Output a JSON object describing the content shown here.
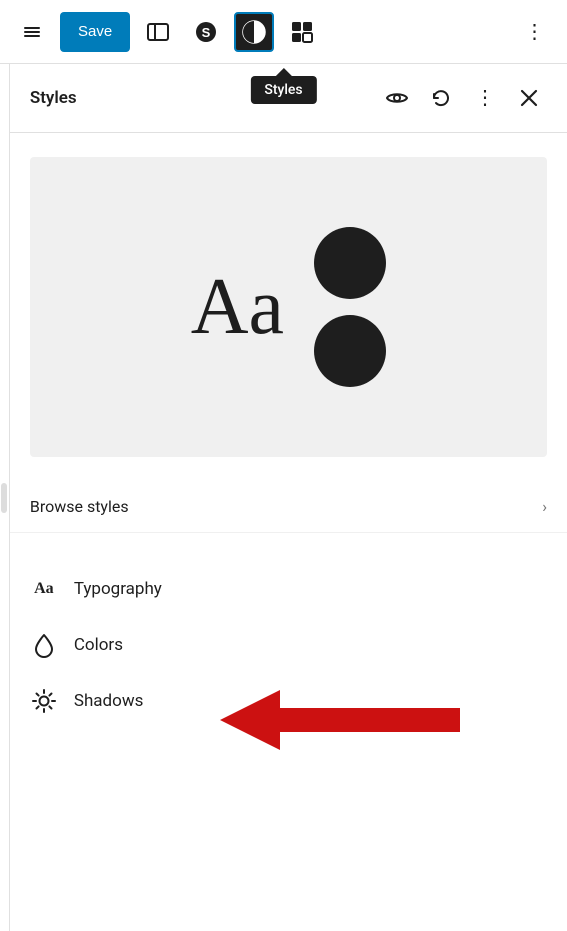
{
  "toolbar": {
    "save_label": "Save",
    "tooltip_label": "Styles",
    "layout_icon_label": "layout",
    "bolt_icon_label": "bolt",
    "styles_icon_label": "styles",
    "blocks_icon_label": "blocks",
    "more_icon_label": "more options"
  },
  "sidebar": {
    "title": "Styles",
    "eye_icon": "preview",
    "history_icon": "history",
    "more_icon": "more options",
    "close_icon": "close"
  },
  "preview": {
    "text": "Aa"
  },
  "browse_styles": {
    "label": "Browse styles",
    "chevron": "›"
  },
  "items": [
    {
      "id": "typography",
      "icon": "Aa",
      "label": "Typography"
    },
    {
      "id": "colors",
      "icon": "drop",
      "label": "Colors"
    },
    {
      "id": "shadows",
      "icon": "sun",
      "label": "Shadows"
    }
  ],
  "arrow": {
    "color": "#cc1111"
  }
}
